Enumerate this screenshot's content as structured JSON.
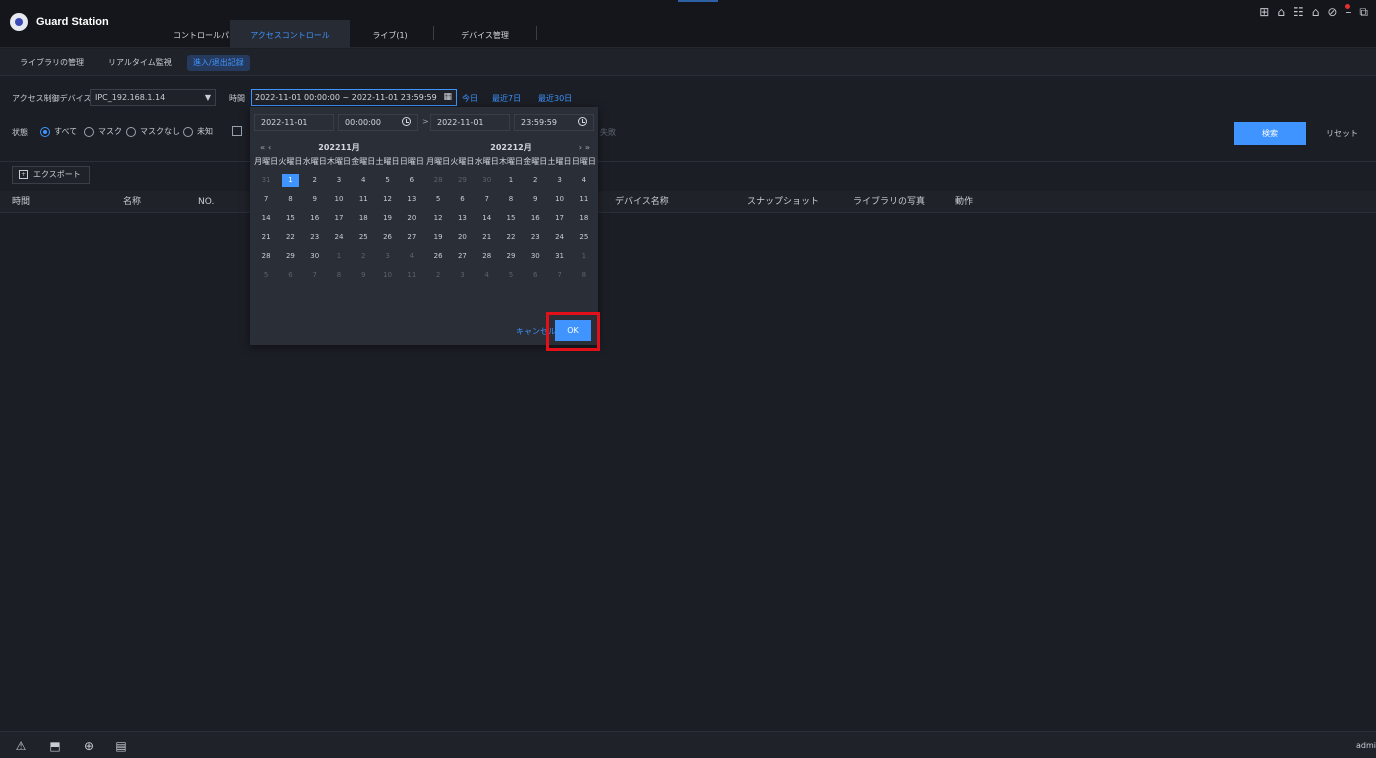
{
  "app": {
    "title": "Guard Station"
  },
  "top_tabs": [
    {
      "label": "コントロールパネル"
    },
    {
      "label": "アクセスコントロール"
    },
    {
      "label": "ライブ(1)"
    },
    {
      "label": "デバイス管理"
    }
  ],
  "sub_tabs": [
    {
      "label": "ライブラリの管理"
    },
    {
      "label": "リアルタイム監視"
    },
    {
      "label": "進入/退出記録"
    }
  ],
  "filters": {
    "device_label": "アクセス制御デバイス",
    "device_value": "IPC_192.168.1.14",
    "time_label": "時間",
    "time_range": "2022-11-01 00:00:00  ~ 2022-11-01 23:59:59",
    "quick": {
      "today": "今日",
      "last7": "最近7日",
      "last30": "最近30日"
    },
    "status_label": "状態",
    "status_options": [
      "すべて",
      "マスク",
      "マスクなし",
      "未知"
    ],
    "hidden_text": "失敗",
    "search_button": "検索",
    "reset_button": "リセット"
  },
  "export_button": "エクスポート",
  "table_headers": {
    "time": "時間",
    "name": "名称",
    "no": "NO.",
    "device_name": "デバイス名称",
    "snapshot": "スナップショット",
    "library_photo": "ライブラリの写真",
    "action": "動作"
  },
  "picker": {
    "start_date": "2022-11-01",
    "start_time": "00:00:00",
    "end_date": "2022-11-01",
    "end_time": "23:59:59",
    "left_month": "202211月",
    "right_month": "202212月",
    "weekdays": [
      "月曜日",
      "火曜日",
      "水曜日",
      "木曜日",
      "金曜日",
      "土曜日",
      "日曜日"
    ],
    "nav_prev": "« ‹",
    "nav_next": "› »",
    "cancel": "キャンセル",
    "ok": "OK"
  },
  "footer": {
    "user": "admi"
  },
  "colors": {
    "accent": "#3f94ff",
    "highlight": "#e3101a",
    "background": "#1b1e25"
  }
}
